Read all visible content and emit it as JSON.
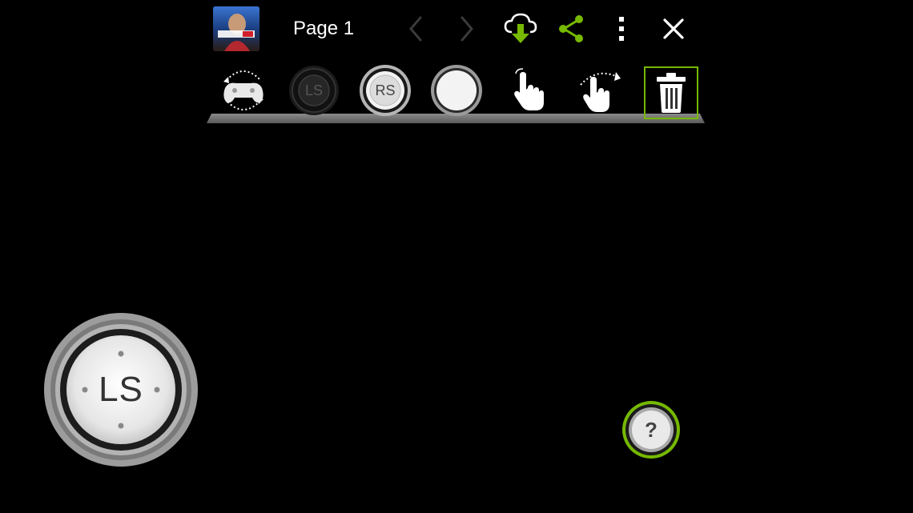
{
  "header": {
    "page_title": "Page 1",
    "thumbnail_icon": "fifa14-game-cover",
    "icons": [
      "chevron-left-icon",
      "chevron-right-icon",
      "cloud-download-icon",
      "share-icon",
      "more-vert-icon",
      "close-icon"
    ]
  },
  "toolbar": {
    "tools": [
      {
        "icon": "controller-rotate-icon"
      },
      {
        "icon": "left-stick-icon",
        "label": "LS"
      },
      {
        "icon": "right-stick-icon",
        "label": "RS"
      },
      {
        "icon": "round-button-icon"
      },
      {
        "icon": "tap-hand-icon"
      },
      {
        "icon": "swipe-hand-icon"
      },
      {
        "icon": "trash-icon",
        "selected": true
      }
    ]
  },
  "canvas": {
    "left_stick_label": "LS",
    "help_label": "?"
  },
  "colors": {
    "accent": "#76b900",
    "background": "#000000"
  }
}
